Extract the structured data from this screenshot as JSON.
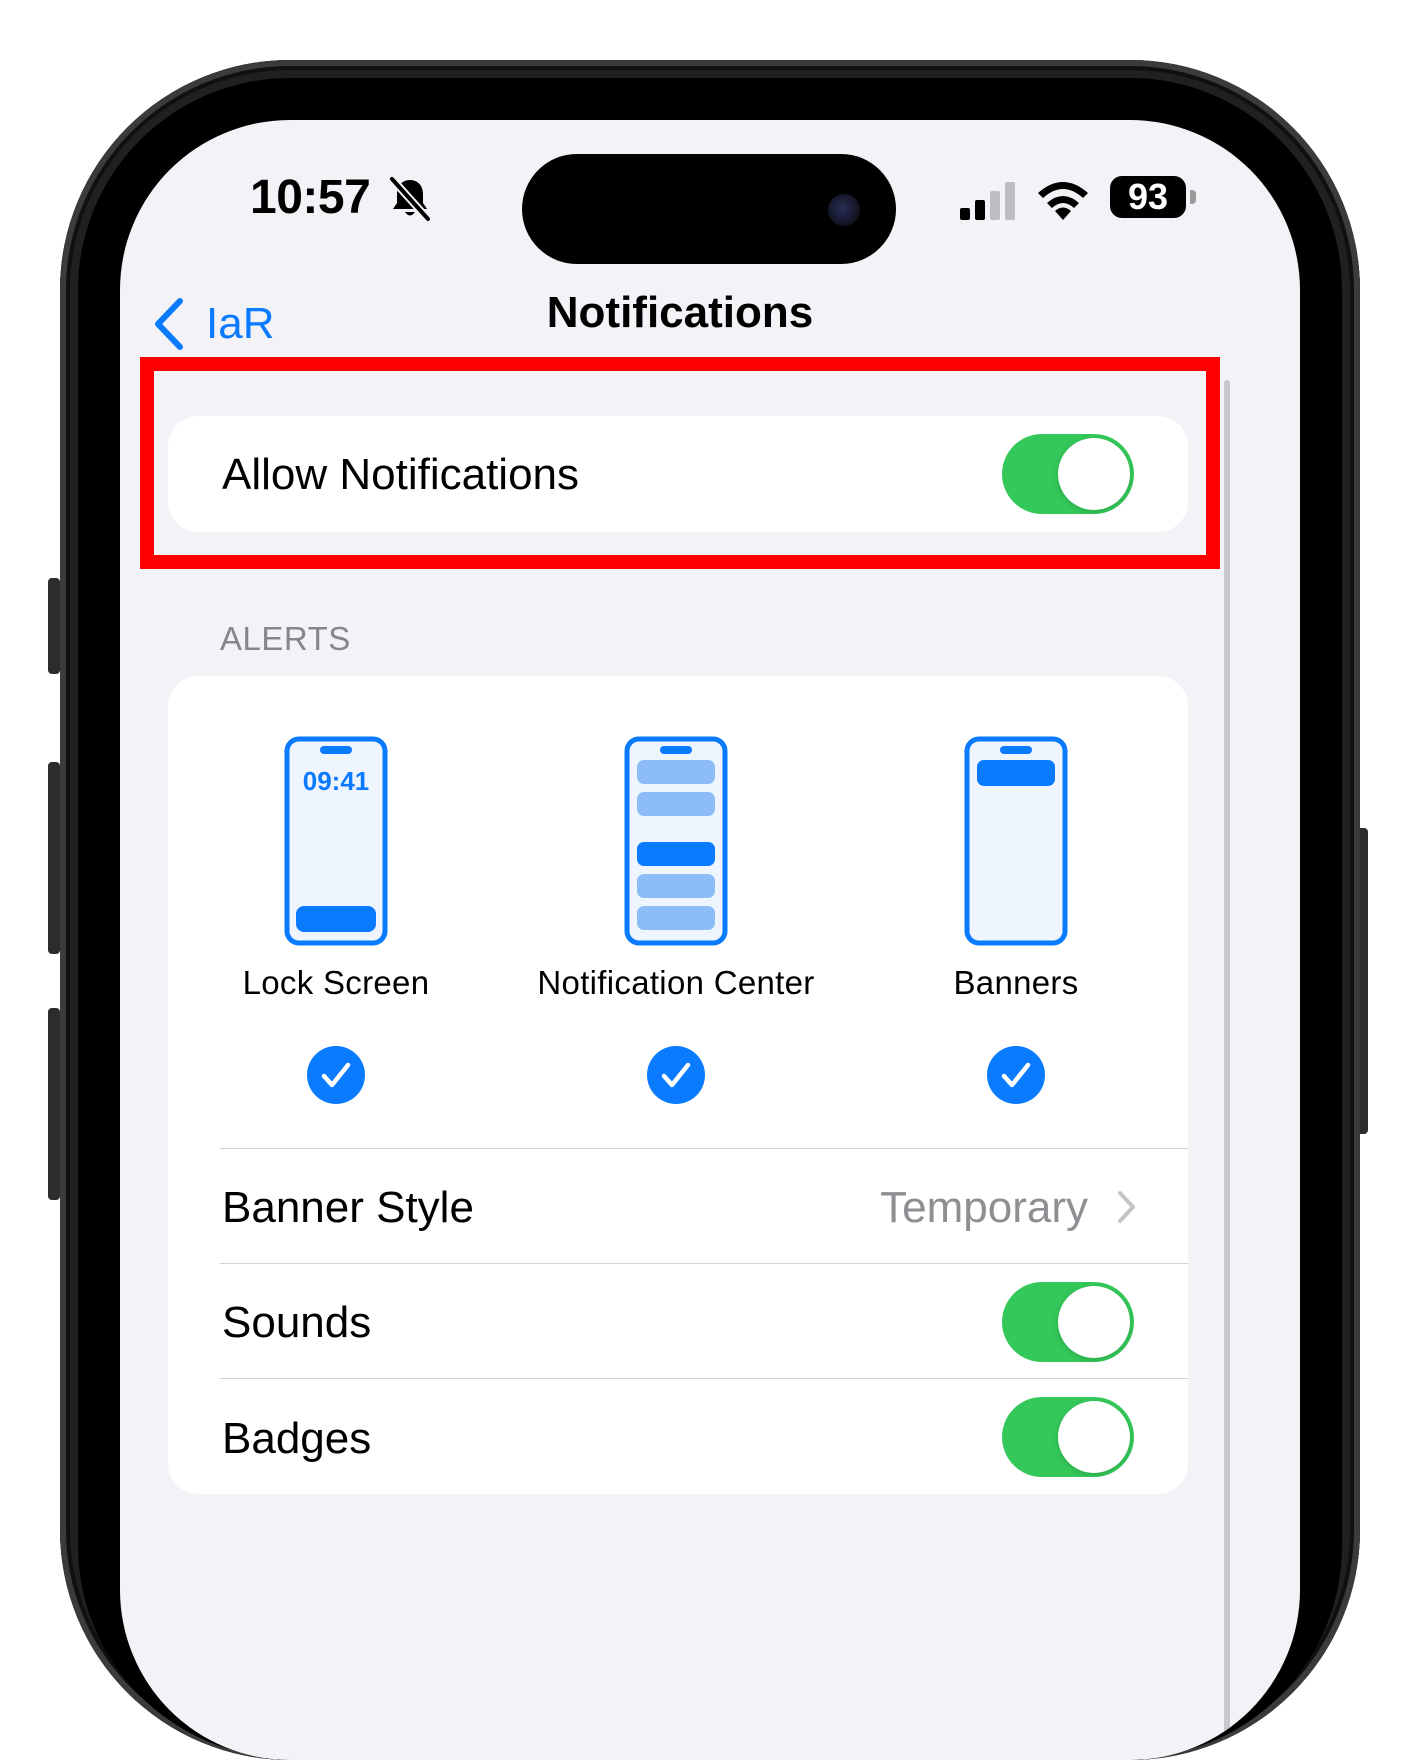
{
  "status_bar": {
    "time": "10:57",
    "battery": "93",
    "icons": [
      "bell-slash-icon",
      "cellular-signal-icon",
      "wifi-icon",
      "battery-icon"
    ]
  },
  "nav": {
    "back_label": "IaR",
    "title": "Notifications"
  },
  "allow_notifications": {
    "label": "Allow Notifications",
    "enabled": true
  },
  "alerts": {
    "header": "ALERTS",
    "options": [
      {
        "label": "Lock Screen",
        "preview_time": "09:41",
        "checked": true
      },
      {
        "label": "Notification Center",
        "checked": true
      },
      {
        "label": "Banners",
        "checked": true
      }
    ],
    "banner_style": {
      "label": "Banner Style",
      "value": "Temporary"
    },
    "sounds": {
      "label": "Sounds",
      "enabled": true
    },
    "badges": {
      "label": "Badges",
      "enabled": true
    }
  },
  "colors": {
    "accent": "#0a7aff",
    "toggle_on": "#34c759",
    "highlight": "#ff0000",
    "background": "#f2f2f7"
  }
}
